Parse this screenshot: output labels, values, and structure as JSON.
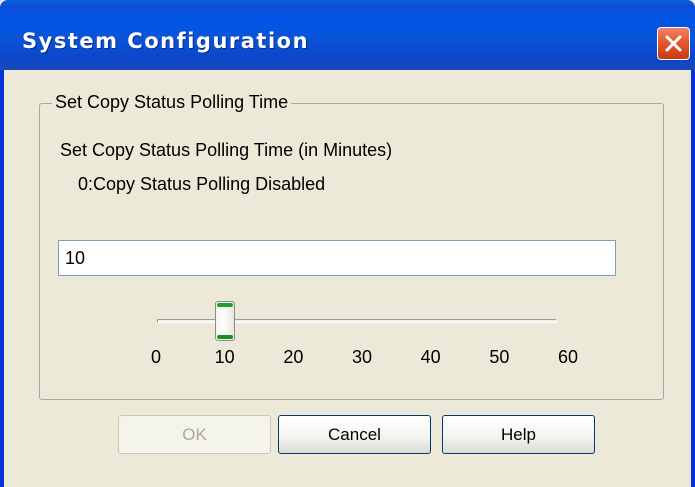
{
  "window": {
    "title": "System Configuration"
  },
  "group": {
    "legend": "Set Copy Status Polling Time",
    "label_line1": "Set Copy Status Polling Time (in Minutes)",
    "label_line2": "0:Copy Status Polling Disabled"
  },
  "input": {
    "value": "10"
  },
  "slider": {
    "min": 0,
    "max": 60,
    "value": 10,
    "ticks": [
      "0",
      "10",
      "20",
      "30",
      "40",
      "50",
      "60"
    ]
  },
  "buttons": {
    "ok": "OK",
    "cancel": "Cancel",
    "help": "Help"
  },
  "colors": {
    "titlebar": "#0055e5",
    "close_button": "#e25a30",
    "dialog_background": "#ece9d8",
    "slider_grip": "#21a121"
  },
  "icons": {
    "close": "close-icon"
  }
}
